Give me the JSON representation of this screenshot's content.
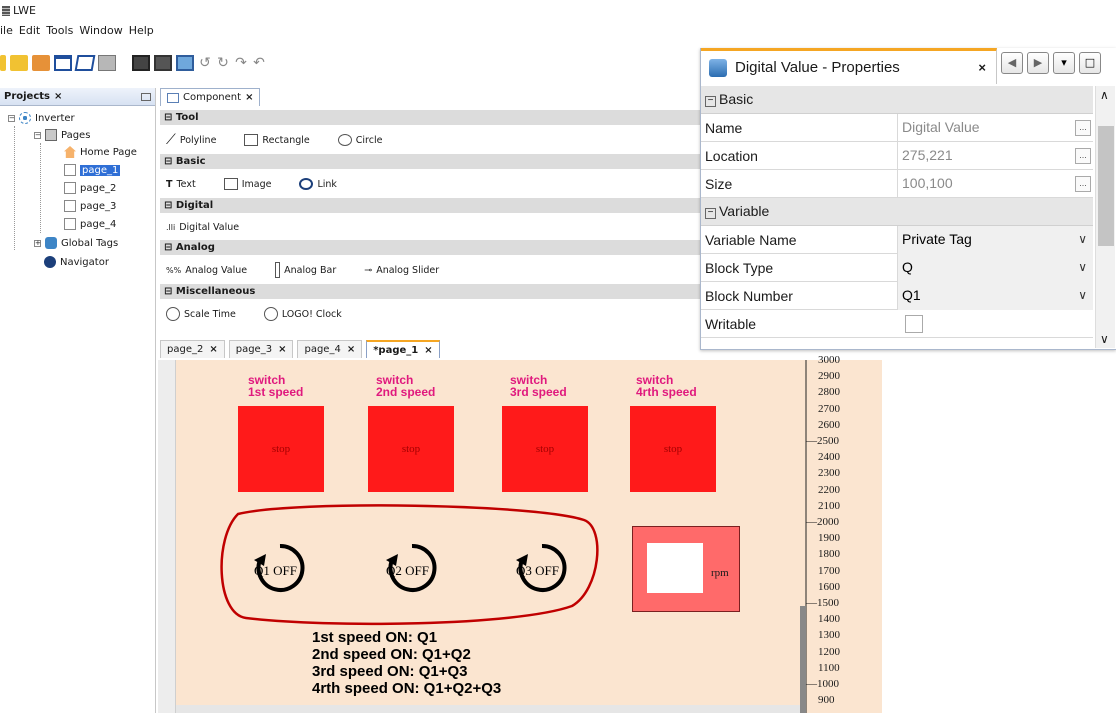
{
  "app": {
    "title": "LWE"
  },
  "menu": [
    "File",
    "Edit",
    "Tools",
    "Window",
    "Help"
  ],
  "menu_display": [
    "ile",
    "Edit",
    "Tools",
    "Window",
    "Help"
  ],
  "projects": {
    "tab_label": "Projects",
    "root": "Inverter",
    "pages_label": "Pages",
    "home_page": "Home Page",
    "pages": [
      "page_1",
      "page_2",
      "page_3",
      "page_4"
    ],
    "selected_page": "page_1",
    "global_tags": "Global Tags",
    "navigator": "Navigator"
  },
  "palette": {
    "tab_label": "Component",
    "sections": {
      "tool": "Tool",
      "basic": "Basic",
      "digital": "Digital",
      "analog": "Analog",
      "misc": "Miscellaneous"
    },
    "tool_items": [
      "Polyline",
      "Rectangle",
      "Circle"
    ],
    "basic_items": [
      "Text",
      "Image",
      "Link"
    ],
    "digital_items": [
      "Digital Value"
    ],
    "analog_items": [
      "Analog Value",
      "Analog Bar",
      "Analog Slider"
    ],
    "misc_items": [
      "Scale Time",
      "LOGO! Clock"
    ]
  },
  "page_tabs": [
    "page_2",
    "page_3",
    "page_4",
    "*page_1"
  ],
  "active_page_tab": "*page_1",
  "canvas": {
    "switches": [
      {
        "label_line1": "switch",
        "label_line2": "1st speed",
        "button": "stop"
      },
      {
        "label_line1": "switch",
        "label_line2": "2nd speed",
        "button": "stop"
      },
      {
        "label_line1": "switch",
        "label_line2": "3rd speed",
        "button": "stop"
      },
      {
        "label_line1": "switch",
        "label_line2": "4rth speed",
        "button": "stop"
      }
    ],
    "rotors": [
      "Q1 OFF",
      "Q2 OFF",
      "Q3 OFF"
    ],
    "rpm_label": "rpm",
    "speed_notes": [
      "1st speed ON: Q1",
      "2nd speed ON: Q1+Q2",
      "3rd speed ON: Q1+Q3",
      "4rth speed ON: Q1+Q2+Q3"
    ],
    "colors": {
      "background": "#fbe5d0",
      "button": "#ff1a1a",
      "switch_label": "#e0197e",
      "rpm_box": "#ff6a6a",
      "annotation": "#c00000"
    }
  },
  "gauge": {
    "ticks": [
      "3000",
      "2900",
      "2800",
      "2700",
      "2600",
      "2500",
      "2400",
      "2300",
      "2200",
      "2100",
      "2000",
      "1900",
      "1800",
      "1700",
      "1600",
      "1500",
      "1400",
      "1300",
      "1200",
      "1100",
      "1000",
      "900"
    ],
    "major_ticks": [
      "2500",
      "2000",
      "1500",
      "1000"
    ]
  },
  "properties": {
    "title": "Digital Value - Properties",
    "sections": {
      "basic": "Basic",
      "variable": "Variable"
    },
    "basic_rows": [
      {
        "key": "Name",
        "value": "Digital Value"
      },
      {
        "key": "Location",
        "value": "275,221"
      },
      {
        "key": "Size",
        "value": "100,100"
      }
    ],
    "variable_rows": [
      {
        "key": "Variable Name",
        "value": "Private Tag"
      },
      {
        "key": "Block Type",
        "value": "Q"
      },
      {
        "key": "Block Number",
        "value": "Q1"
      }
    ],
    "writable_label": "Writable"
  }
}
